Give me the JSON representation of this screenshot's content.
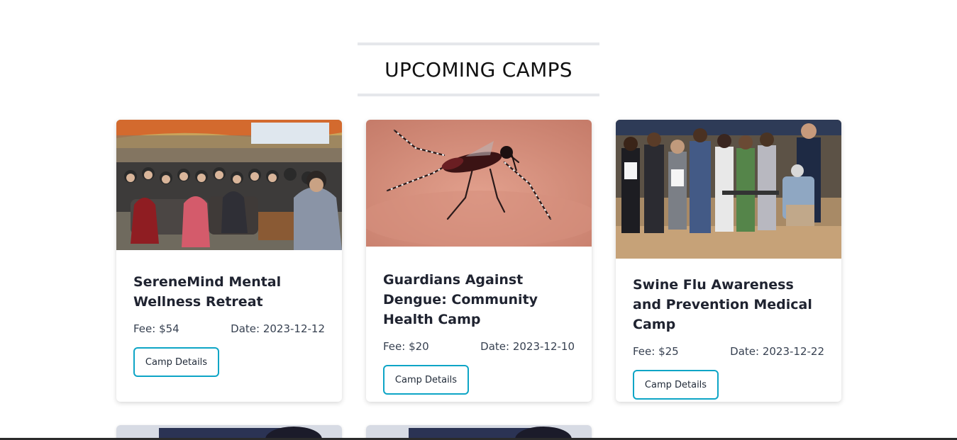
{
  "section": {
    "title": "UPCOMING CAMPS"
  },
  "camps": [
    {
      "title": "SereneMind Mental Wellness Retreat",
      "fee": "Fee: $54",
      "date": "Date: 2023-12-12",
      "button_label": "Camp Details",
      "image_icon": "crowd-meeting-photo"
    },
    {
      "title": "Guardians Against Dengue: Community Health Camp",
      "fee": "Fee: $20",
      "date": "Date: 2023-12-10",
      "button_label": "Camp Details",
      "image_icon": "mosquito-photo"
    },
    {
      "title": "Swine Flu Awareness and Prevention Medical Camp",
      "fee": "Fee: $25",
      "date": "Date: 2023-12-22",
      "button_label": "Camp Details",
      "image_icon": "students-line-photo"
    }
  ],
  "colors": {
    "accent": "#0ea5c6",
    "divider": "#e5e7eb",
    "title_text": "#1f2330"
  }
}
